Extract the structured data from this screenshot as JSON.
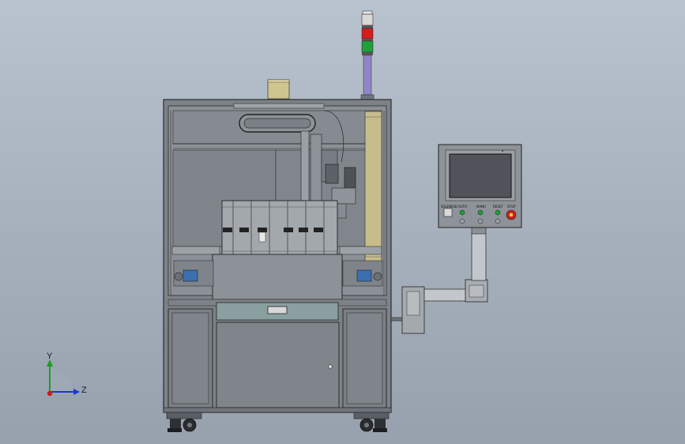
{
  "triad": {
    "y_label": "Y",
    "z_label": "Z"
  },
  "control_panel": {
    "switch_labels": [
      "SOLENOID",
      "AUTO",
      "MANU",
      "RESET",
      "STOP"
    ]
  },
  "colors": {
    "background_top": "#b9c3cf",
    "background_bottom": "#97a1ad",
    "frame": "#7d8288",
    "panel_face": "#8e9399",
    "screen": "#52535a",
    "signal_red": "#d21e1e",
    "signal_green": "#1ea03a",
    "tube_khaki": "#c7bd8a",
    "pole_purple": "#8f86c9",
    "drawer_teal": "#8aa0a0",
    "axis_y": "#1aa01a",
    "axis_z": "#1a3ad0",
    "axis_origin": "#d01a1a"
  },
  "icons": [
    "signal-tower-icon",
    "emergency-stop-icon",
    "axis-triad-icon",
    "door-lock-icon"
  ]
}
